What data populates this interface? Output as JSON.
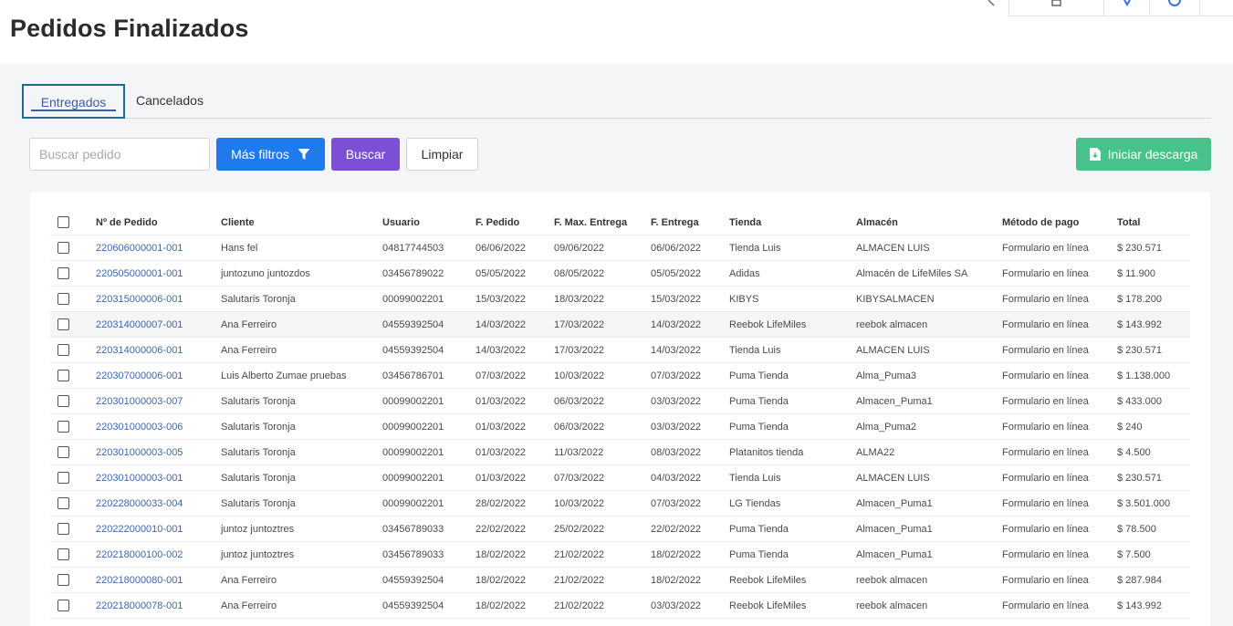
{
  "page": {
    "title": "Pedidos Finalizados"
  },
  "tabs": [
    {
      "label": "Entregados",
      "active": true
    },
    {
      "label": "Cancelados",
      "active": false
    }
  ],
  "toolbar": {
    "search_placeholder": "Buscar pedido",
    "filters_label": "Más filtros",
    "search_label": "Buscar",
    "clear_label": "Limpiar",
    "download_label": "Iniciar descarga"
  },
  "colors": {
    "primary": "#1f7aed",
    "search": "#7b4fd6",
    "download": "#48c28a",
    "link": "#3f67a9",
    "tab_active": "#3b5ea8"
  },
  "table": {
    "columns": [
      "Nº de Pedido",
      "Cliente",
      "Usuario",
      "F. Pedido",
      "F. Max. Entrega",
      "F. Entrega",
      "Tienda",
      "Almacén",
      "Método de pago",
      "Total"
    ],
    "rows": [
      {
        "order": "220606000001-001",
        "client": "Hans fel",
        "user": "04817744503",
        "f_pedido": "06/06/2022",
        "f_max": "09/06/2022",
        "f_entrega": "06/06/2022",
        "store": "Tienda Luis",
        "warehouse": "ALMACEN LUIS",
        "payment": "Formulario en línea",
        "total": "$ 230.571"
      },
      {
        "order": "220505000001-001",
        "client": "juntozuno juntozdos",
        "user": "03456789022",
        "f_pedido": "05/05/2022",
        "f_max": "08/05/2022",
        "f_entrega": "05/05/2022",
        "store": "Adidas",
        "warehouse": "Almacén de LifeMiles SA",
        "payment": "Formulario en línea",
        "total": "$ 11.900"
      },
      {
        "order": "220315000006-001",
        "client": "Salutaris Toronja",
        "user": "00099002201",
        "f_pedido": "15/03/2022",
        "f_max": "18/03/2022",
        "f_entrega": "15/03/2022",
        "store": "KIBYS",
        "warehouse": "KIBYSALMACEN",
        "payment": "Formulario en línea",
        "total": "$ 178.200"
      },
      {
        "order": "220314000007-001",
        "client": "Ana Ferreiro",
        "user": "04559392504",
        "f_pedido": "14/03/2022",
        "f_max": "17/03/2022",
        "f_entrega": "14/03/2022",
        "store": "Reebok LifeMiles",
        "warehouse": "reebok almacen",
        "payment": "Formulario en línea",
        "total": "$ 143.992",
        "highlighted": true
      },
      {
        "order": "220314000006-001",
        "client": "Ana Ferreiro",
        "user": "04559392504",
        "f_pedido": "14/03/2022",
        "f_max": "17/03/2022",
        "f_entrega": "14/03/2022",
        "store": "Tienda Luis",
        "warehouse": "ALMACEN LUIS",
        "payment": "Formulario en línea",
        "total": "$ 230.571"
      },
      {
        "order": "220307000006-001",
        "client": "Luis Alberto Zumae pruebas",
        "user": "03456786701",
        "f_pedido": "07/03/2022",
        "f_max": "10/03/2022",
        "f_entrega": "07/03/2022",
        "store": "Puma Tienda",
        "warehouse": "Alma_Puma3",
        "payment": "Formulario en línea",
        "total": "$ 1.138.000"
      },
      {
        "order": "220301000003-007",
        "client": "Salutaris Toronja",
        "user": "00099002201",
        "f_pedido": "01/03/2022",
        "f_max": "06/03/2022",
        "f_entrega": "03/03/2022",
        "store": "Puma Tienda",
        "warehouse": "Almacen_Puma1",
        "payment": "Formulario en línea",
        "total": "$ 433.000"
      },
      {
        "order": "220301000003-006",
        "client": "Salutaris Toronja",
        "user": "00099002201",
        "f_pedido": "01/03/2022",
        "f_max": "06/03/2022",
        "f_entrega": "03/03/2022",
        "store": "Puma Tienda",
        "warehouse": "Alma_Puma2",
        "payment": "Formulario en línea",
        "total": "$ 240"
      },
      {
        "order": "220301000003-005",
        "client": "Salutaris Toronja",
        "user": "00099002201",
        "f_pedido": "01/03/2022",
        "f_max": "11/03/2022",
        "f_entrega": "08/03/2022",
        "store": "Platanitos tienda",
        "warehouse": "ALMA22",
        "payment": "Formulario en línea",
        "total": "$ 4.500"
      },
      {
        "order": "220301000003-001",
        "client": "Salutaris Toronja",
        "user": "00099002201",
        "f_pedido": "01/03/2022",
        "f_max": "07/03/2022",
        "f_entrega": "04/03/2022",
        "store": "Tienda Luis",
        "warehouse": "ALMACEN LUIS",
        "payment": "Formulario en línea",
        "total": "$ 230.571"
      },
      {
        "order": "220228000033-004",
        "client": "Salutaris Toronja",
        "user": "00099002201",
        "f_pedido": "28/02/2022",
        "f_max": "10/03/2022",
        "f_entrega": "07/03/2022",
        "store": "LG Tiendas",
        "warehouse": "Almacen_Puma1",
        "payment": "Formulario en línea",
        "total": "$ 3.501.000"
      },
      {
        "order": "220222000010-001",
        "client": "juntoz juntoztres",
        "user": "03456789033",
        "f_pedido": "22/02/2022",
        "f_max": "25/02/2022",
        "f_entrega": "22/02/2022",
        "store": "Puma Tienda",
        "warehouse": "Almacen_Puma1",
        "payment": "Formulario en línea",
        "total": "$ 78.500"
      },
      {
        "order": "220218000100-002",
        "client": "juntoz juntoztres",
        "user": "03456789033",
        "f_pedido": "18/02/2022",
        "f_max": "21/02/2022",
        "f_entrega": "18/02/2022",
        "store": "Puma Tienda",
        "warehouse": "Almacen_Puma1",
        "payment": "Formulario en línea",
        "total": "$ 7.500"
      },
      {
        "order": "220218000080-001",
        "client": "Ana Ferreiro",
        "user": "04559392504",
        "f_pedido": "18/02/2022",
        "f_max": "21/02/2022",
        "f_entrega": "18/02/2022",
        "store": "Reebok LifeMiles",
        "warehouse": "reebok almacen",
        "payment": "Formulario en línea",
        "total": "$ 287.984"
      },
      {
        "order": "220218000078-001",
        "client": "Ana Ferreiro",
        "user": "04559392504",
        "f_pedido": "18/02/2022",
        "f_max": "21/02/2022",
        "f_entrega": "03/03/2022",
        "store": "Reebok LifeMiles",
        "warehouse": "reebok almacen",
        "payment": "Formulario en línea",
        "total": "$ 143.992"
      }
    ]
  }
}
